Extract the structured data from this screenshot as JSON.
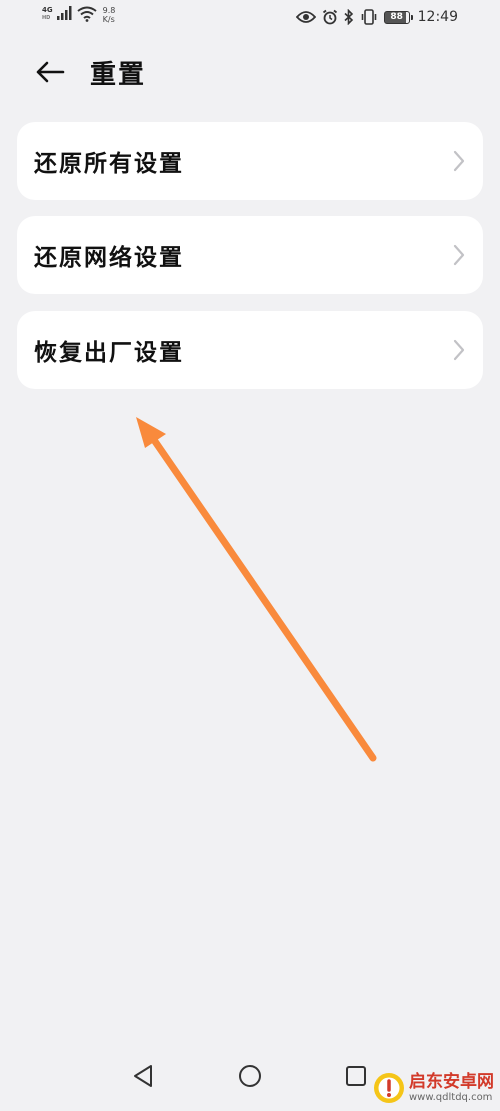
{
  "status_bar": {
    "network_type": "4G",
    "network_sub": "HD",
    "speed_value": "9.8",
    "speed_unit": "K/s",
    "battery_level": "88",
    "time": "12:49"
  },
  "header": {
    "title": "重置"
  },
  "menu": {
    "items": [
      {
        "label": "还原所有设置"
      },
      {
        "label": "还原网络设置"
      },
      {
        "label": "恢复出厂设置"
      }
    ]
  },
  "annotation": {
    "arrow_color": "#f98a3c"
  },
  "watermark": {
    "title": "启东安卓网",
    "url": "www.qdltdq.com"
  }
}
